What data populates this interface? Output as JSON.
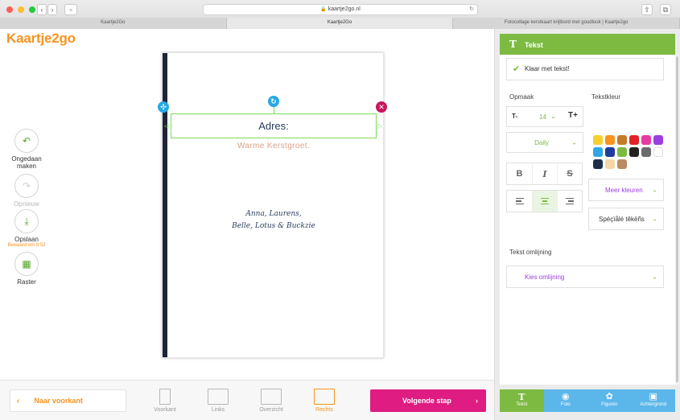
{
  "browser": {
    "address": "kaartje2go.nl",
    "tabs": [
      {
        "label": "Kaartje2Go"
      },
      {
        "label": "Kaartje2Go"
      },
      {
        "label": "Fotocollage kerstkaart krijtbord met goudlook | Kaartje2go"
      }
    ]
  },
  "brand": {
    "logo": "Kaartje2go",
    "accent": "#f7931e"
  },
  "tools": {
    "undo": {
      "label": "Ongedaan maken",
      "icon": "undo-icon"
    },
    "redo": {
      "label": "Opnieuw",
      "icon": "redo-icon"
    },
    "save": {
      "label": "Opslaan",
      "saved": "Bewaard om 9:52",
      "icon": "download-icon"
    },
    "grid": {
      "label": "Raster",
      "icon": "grid-icon"
    }
  },
  "card": {
    "address": "Adres:",
    "greeting": "Warme Kerstgroet.",
    "signature_line1": "Anna, Laurens,",
    "signature_line2": "Belle, Lotus & Buckzie"
  },
  "bottom": {
    "prev": "Naar voorkant",
    "next": "Volgende stap",
    "views": [
      {
        "label": "Voorkant"
      },
      {
        "label": "Links"
      },
      {
        "label": "Overzicht"
      },
      {
        "label": "Rechts"
      }
    ]
  },
  "panel": {
    "title": "Tekst",
    "done": "Klaar met tekst!",
    "format_label": "Opmaak",
    "text_color_label": "Tekstkleur",
    "font_size": "14",
    "font_size_down": "T-",
    "font_size_up": "T+",
    "font": "Daily",
    "bold": "B",
    "italic": "I",
    "strike": "S",
    "more_colors": "Meer kleuren",
    "special_chars": "Spéçïålé têkëñs",
    "outline_label": "Tekst omlijning",
    "outline_select": "Kies omlijning",
    "swatches": [
      "#f7d02e",
      "#f7931e",
      "#c47b2a",
      "#e3222a",
      "#e63aa6",
      "#9b3ee0",
      "#2fa6e8",
      "#1f3c9e",
      "#7dba42",
      "#222222",
      "#6b6b6b",
      "#ffffff",
      "#1d2e4a",
      "#f3d7a6",
      "#b98c63"
    ]
  },
  "footer_tabs": [
    {
      "label": "Tekst",
      "icon": "text-icon"
    },
    {
      "label": "Foto",
      "icon": "camera-icon"
    },
    {
      "label": "Figuren",
      "icon": "shapes-icon"
    },
    {
      "label": "Achtergrond",
      "icon": "image-icon"
    }
  ]
}
